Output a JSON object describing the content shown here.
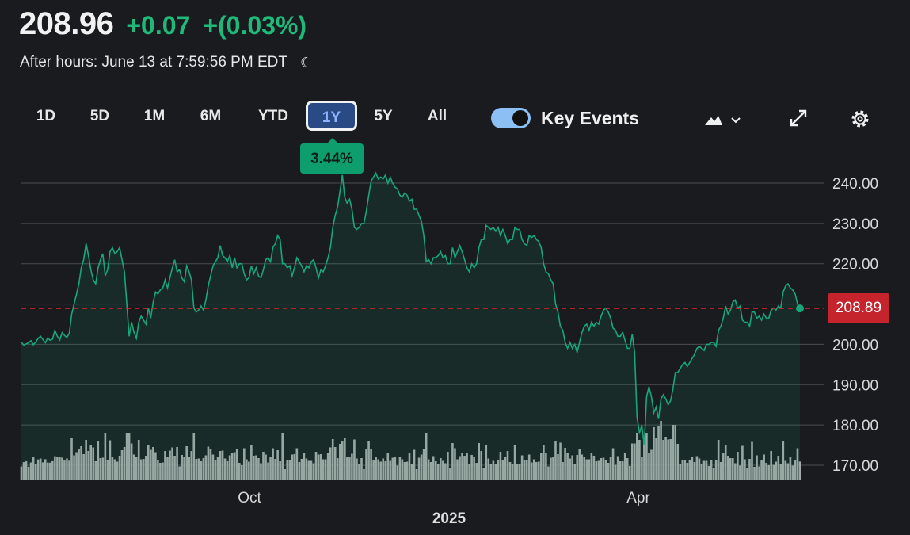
{
  "quote": {
    "price": "208.96",
    "change": "+0.07",
    "change_pct": "+(0.03%)",
    "after_hours": "After hours: June 13 at 7:59:56 PM EDT",
    "session_icon": "moon-icon"
  },
  "toolbar": {
    "ranges": [
      "1D",
      "5D",
      "1M",
      "6M",
      "YTD",
      "1Y",
      "5Y",
      "All"
    ],
    "active_range": "1Y",
    "key_events_label": "Key Events",
    "key_events_on": true,
    "icons": [
      "mountain-chart-icon",
      "chevron-down-icon",
      "expand-icon",
      "gear-icon"
    ]
  },
  "performance_badge": "3.44%",
  "last_price_tag": "208.89",
  "colors": {
    "up": "#1fb97a",
    "line": "#17a77a",
    "reference": "#c6242c",
    "volume": "#a7a7a7",
    "active_range_bg": "#2a4a86"
  },
  "chart_data": {
    "type": "area",
    "x_tick_labels": [
      "Oct",
      "Apr"
    ],
    "x_year_label": "2025",
    "y_tick_labels": [
      "240.00",
      "230.00",
      "220.00",
      "210.00",
      "200.00",
      "190.00",
      "180.00",
      "170.00"
    ],
    "ylim": [
      167,
      243
    ],
    "reference_line": 208.89,
    "grid": true,
    "series": [
      {
        "values": [
          200.5,
          199.8,
          200.1,
          200.4,
          200.9,
          199.9,
          200.6,
          201.5,
          202.0,
          201.2,
          200.4,
          201.6,
          201.0,
          201.3,
          203.5,
          202.0,
          201.1,
          202.9,
          202.2,
          201.7,
          202.8,
          207.5,
          210.0,
          212.5,
          215.0,
          219.0,
          221.0,
          225.0,
          222.0,
          218.5,
          216.0,
          215.0,
          219.0,
          221.0,
          222.5,
          217.0,
          218.5,
          223.0,
          224.0,
          222.5,
          223.0,
          224.0,
          221.0,
          218.0,
          210.0,
          202.0,
          205.5,
          203.0,
          201.5,
          205.5,
          207.0,
          206.0,
          205.0,
          209.0,
          206.5,
          210.5,
          213.0,
          212.5,
          213.5,
          214.0,
          216.0,
          214.0,
          216.5,
          219.0,
          221.0,
          218.0,
          218.5,
          216.5,
          215.5,
          219.5,
          218.0,
          216.0,
          209.0,
          208.0,
          208.5,
          209.5,
          208.5,
          211.0,
          214.5,
          217.0,
          219.5,
          220.5,
          221.5,
          224.5,
          222.0,
          221.5,
          220.5,
          222.0,
          219.0,
          221.5,
          219.0,
          220.0,
          220.0,
          217.5,
          216.0,
          216.5,
          219.5,
          217.5,
          219.0,
          217.0,
          216.5,
          218.5,
          221.0,
          221.5,
          220.5,
          224.0,
          225.0,
          227.0,
          226.0,
          220.0,
          220.0,
          219.0,
          219.5,
          217.0,
          219.0,
          221.5,
          220.5,
          219.5,
          218.0,
          219.5,
          219.0,
          220.5,
          221.0,
          219.0,
          216.5,
          218.5,
          218.0,
          219.5,
          221.5,
          224.0,
          229.0,
          232.0,
          234.0,
          238.0,
          242.0,
          236.5,
          235.0,
          236.0,
          233.5,
          229.0,
          228.5,
          229.0,
          230.0,
          230.0,
          233.0,
          237.0,
          240.5,
          241.5,
          242.5,
          241.0,
          241.5,
          241.0,
          242.0,
          240.0,
          241.5,
          240.0,
          239.0,
          238.5,
          237.0,
          236.5,
          237.5,
          237.0,
          235.5,
          236.0,
          233.5,
          233.5,
          232.0,
          230.5,
          227.0,
          220.5,
          221.0,
          220.0,
          221.5,
          221.5,
          222.0,
          223.0,
          221.5,
          222.0,
          220.0,
          220.0,
          224.0,
          221.5,
          223.0,
          224.5,
          223.0,
          221.0,
          219.0,
          218.0,
          220.0,
          219.0,
          220.0,
          224.0,
          226.0,
          226.0,
          229.5,
          229.0,
          228.5,
          229.0,
          228.0,
          229.0,
          227.0,
          228.5,
          227.0,
          225.0,
          226.0,
          226.0,
          229.0,
          228.5,
          228.5,
          226.0,
          225.0,
          224.5,
          227.0,
          226.5,
          227.0,
          226.0,
          225.5,
          224.0,
          220.0,
          218.0,
          217.5,
          216.0,
          215.0,
          210.0,
          208.0,
          204.5,
          203.5,
          200.5,
          199.0,
          200.5,
          199.0,
          200.0,
          198.0,
          200.5,
          203.0,
          204.5,
          205.0,
          203.5,
          205.5,
          204.5,
          205.5,
          205.0,
          207.0,
          208.5,
          209.0,
          208.0,
          206.5,
          204.0,
          203.5,
          202.0,
          202.0,
          203.0,
          201.0,
          199.0,
          199.0,
          202.5,
          198.0,
          182.0,
          178.0,
          180.0,
          175.0,
          187.0,
          189.5,
          187.0,
          183.0,
          184.5,
          181.5,
          186.5,
          187.5,
          186.5,
          185.0,
          186.0,
          189.0,
          193.0,
          193.0,
          194.0,
          195.0,
          195.5,
          194.5,
          195.5,
          196.5,
          197.5,
          199.0,
          199.5,
          199.0,
          198.5,
          200.0,
          200.0,
          200.5,
          200.5,
          199.5,
          203.5,
          204.5,
          206.5,
          209.5,
          207.5,
          208.5,
          210.5,
          211.0,
          209.0,
          209.5,
          206.0,
          205.5,
          205.5,
          204.5,
          208.0,
          208.0,
          206.5,
          207.0,
          206.0,
          207.5,
          206.5,
          206.5,
          208.5,
          209.0,
          208.5,
          209.5,
          209.0,
          213.0,
          214.5,
          215.0,
          214.0,
          213.5,
          212.5,
          210.0,
          208.9
        ]
      }
    ]
  }
}
